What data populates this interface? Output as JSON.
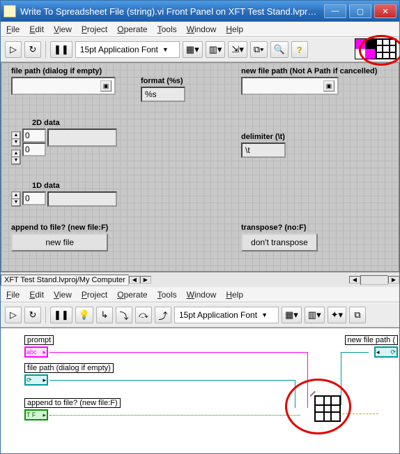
{
  "titlebar": {
    "title": "Write To Spreadsheet File (string).vi Front Panel on XFT Test Stand.lvproj/My C..."
  },
  "menu": {
    "file": "File",
    "edit": "Edit",
    "view": "View",
    "project": "Project",
    "operate": "Operate",
    "tools": "Tools",
    "window": "Window",
    "help": "Help"
  },
  "toolbar": {
    "font": "15pt Application Font",
    "pause_glyph": "❚❚"
  },
  "fp": {
    "file_path_label": "file path (dialog if empty)",
    "new_file_path_label": "new file path (Not A Path if cancelled)",
    "format_label": "format (%s)",
    "format_value": "%s",
    "two_d_label": "2D data",
    "one_d_label": "1D data",
    "delimiter_label": "delimiter (\\t)",
    "delimiter_value": "\\t",
    "append_label": "append to file? (new file:F)",
    "append_btn": "new file",
    "transpose_label": "transpose? (no:F)",
    "transpose_btn": "don't transpose",
    "arr_index_a": "0",
    "arr_index_b": "0",
    "arr1d_index": "0"
  },
  "status": {
    "path": "XFT Test Stand.lvproj/My Computer"
  },
  "bd": {
    "menu_same": true,
    "font": "15pt Application Font",
    "prompt_label": "prompt",
    "prompt_term": "abc",
    "filepath_label": "file path (dialog if empty)",
    "append_label": "append to file? (new file:F)",
    "append_term": "T F",
    "newfilepath_label": "new file path ("
  }
}
